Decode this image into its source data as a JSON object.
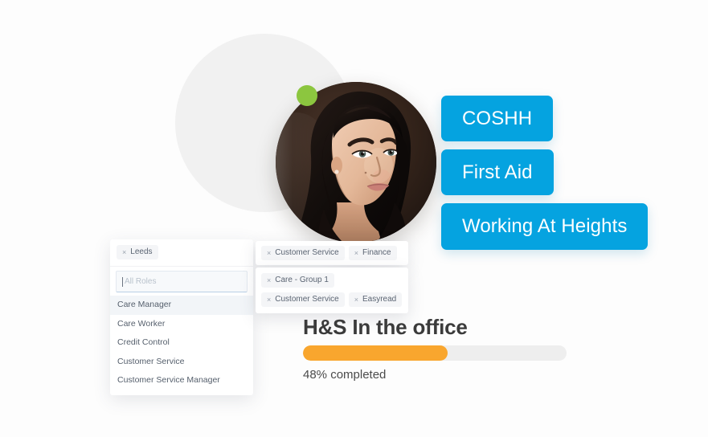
{
  "brand": {
    "accent_blue": "#05a3e0",
    "accent_orange": "#f9a62e",
    "status_green": "#8cc63f",
    "page_background": "#fcfcfc"
  },
  "portrait": {
    "alt": "smiling-woman-portrait",
    "status": "online"
  },
  "course_pills": [
    {
      "label": "COSHH"
    },
    {
      "label": "First Aid"
    },
    {
      "label": "Working At Heights"
    }
  ],
  "location_selector": {
    "selected_chips": [
      {
        "label": "Leeds",
        "remove": "×"
      }
    ],
    "role_input": {
      "value": "",
      "placeholder": "All Roles"
    },
    "options": [
      {
        "label": "Care Manager",
        "selected": true
      },
      {
        "label": "Care Worker",
        "selected": false
      },
      {
        "label": "Credit Control",
        "selected": false
      },
      {
        "label": "Customer Service",
        "selected": false
      },
      {
        "label": "Customer Service Manager",
        "selected": false
      }
    ]
  },
  "tag_cards": {
    "departments": [
      {
        "label": "Customer Service",
        "remove": "×"
      },
      {
        "label": "Finance",
        "remove": "×"
      }
    ],
    "groups": [
      {
        "label": "Care - Group 1",
        "remove": "×"
      },
      {
        "label": "Customer Service",
        "remove": "×"
      },
      {
        "label": "Easyread",
        "remove": "×"
      }
    ]
  },
  "progress": {
    "title": "H&S In the office",
    "percent": 48,
    "fill_width": "55%",
    "status_label": "48% completed"
  }
}
